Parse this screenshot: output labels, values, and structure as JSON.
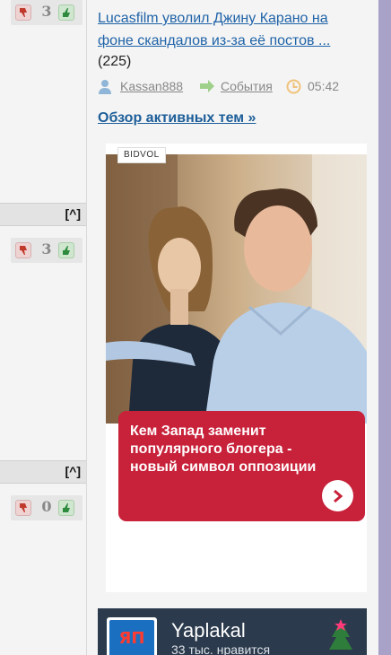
{
  "left_column": {
    "votes": [
      {
        "count": "3"
      },
      {
        "count": "3"
      },
      {
        "count": "0"
      }
    ],
    "collapse_label": "[^]"
  },
  "topic": {
    "title": "Lucasfilm уволил Джину Карано на фоне скандалов из-за её постов ...",
    "count": "(225)",
    "author": "Kassan888",
    "category": "События",
    "time": "05:42"
  },
  "overview_link": "Обзор активных тем »",
  "ad": {
    "badge": "BIDVOL",
    "caption": "Кем Запад заменит популярного блогера - новый символ оппозиции",
    "accent_color": "#c8213a"
  },
  "widget": {
    "logo_text": "ЯП",
    "name": "Yaplakal",
    "likes": "33 тыс. нравится"
  },
  "colors": {
    "link": "#1f63a8",
    "sidebar_strip": "#a8a2c8"
  }
}
